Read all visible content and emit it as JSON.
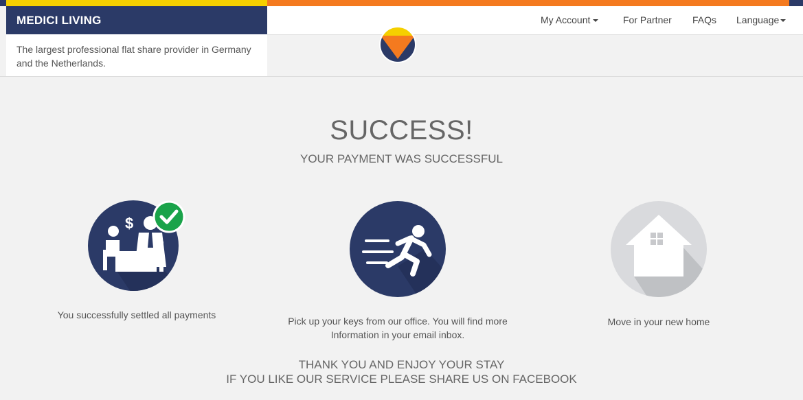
{
  "colors": {
    "navy": "#2b3a67",
    "yellow": "#f5d000",
    "orange": "#f47a1f",
    "check_green": "#1aa34a",
    "grey_icon": "#d9dadd"
  },
  "header": {
    "brand": "MEDICI LIVING",
    "tagline": "The largest professional flat share provider in Germany and the Netherlands."
  },
  "nav": {
    "my_account": "My Account",
    "for_partner": "For Partner",
    "faqs": "FAQs",
    "language": "Language"
  },
  "main": {
    "title": "SUCCESS!",
    "subtitle": "YOUR PAYMENT WAS SUCCESSFUL"
  },
  "steps": [
    {
      "icon": "payment-settled-icon",
      "text": "You successfully settled all payments"
    },
    {
      "icon": "running-person-icon",
      "text": "Pick up your keys from our office. You will find more Information in your email inbox."
    },
    {
      "icon": "house-icon",
      "text": "Move in your new home"
    }
  ],
  "footer": {
    "line1": "THANK YOU AND ENJOY YOUR STAY",
    "line2": "IF YOU LIKE OUR SERVICE PLEASE SHARE US ON FACEBOOK"
  }
}
